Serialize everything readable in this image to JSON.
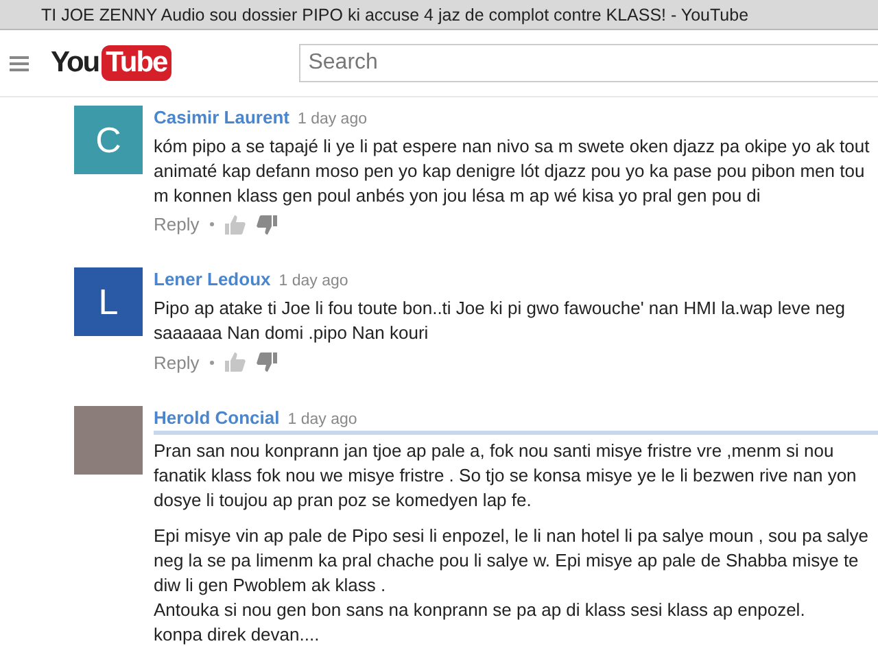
{
  "window": {
    "title": "TI JOE ZENNY Audio sou dossier PIPO ki accuse 4 jaz de complot contre KLASS! - YouTube"
  },
  "header": {
    "logo": {
      "left": "You",
      "right": "Tube"
    },
    "search": {
      "placeholder": "Search"
    }
  },
  "comments": [
    {
      "avatar": {
        "kind": "letter",
        "letter": "C",
        "color": "#3d9aa8"
      },
      "author": "Casimir Laurent",
      "time": "1 day ago",
      "highlighted": false,
      "paragraphs": [
        [
          "kóm pipo a se tapajé li ye li pat espere nan nivo sa m swete oken djazz pa okipe yo ak tout",
          "animaté kap defann moso pen yo kap denigre lót djazz pou yo ka pase pou pibon men tou",
          "m konnen klass gen poul anbés yon jou lésa m ap wé  kisa yo pral gen pou di"
        ]
      ],
      "reply": "Reply"
    },
    {
      "avatar": {
        "kind": "letter",
        "letter": "L",
        "color": "#2a5aa6"
      },
      "author": "Lener Ledoux",
      "time": "1 day ago",
      "highlighted": false,
      "paragraphs": [
        [
          "Pipo ap atake ti Joe li fou toute bon..ti Joe ki pi gwo fawouche' nan HMI la.wap leve neg",
          "saaaaaa Nan domi .pipo Nan kouri"
        ]
      ],
      "reply": "Reply"
    },
    {
      "avatar": {
        "kind": "photo"
      },
      "author": "Herold Concial",
      "time": "1 day ago",
      "highlighted": true,
      "paragraphs": [
        [
          "Pran san nou konprann jan tjoe ap pale a, fok nou santi misye fristre vre ,menm si nou",
          "fanatik klass fok nou we misye fristre . So tjo se konsa misye ye le li bezwen rive nan yon",
          "dosye li toujou ap pran poz se komedyen lap fe."
        ],
        [
          "Epi misye vin ap pale de Pipo sesi li enpozel, le li nan hotel li pa salye moun , sou pa salye",
          "neg la se pa limenm ka pral chache pou li salye w. Epi misye ap pale de Shabba misye te",
          "diw li gen Pwoblem ak klass .",
          "Antouka si nou gen bon sans na konprann se pa ap di klass sesi klass ap enpozel.",
          "konpa direk devan...."
        ]
      ]
    }
  ]
}
